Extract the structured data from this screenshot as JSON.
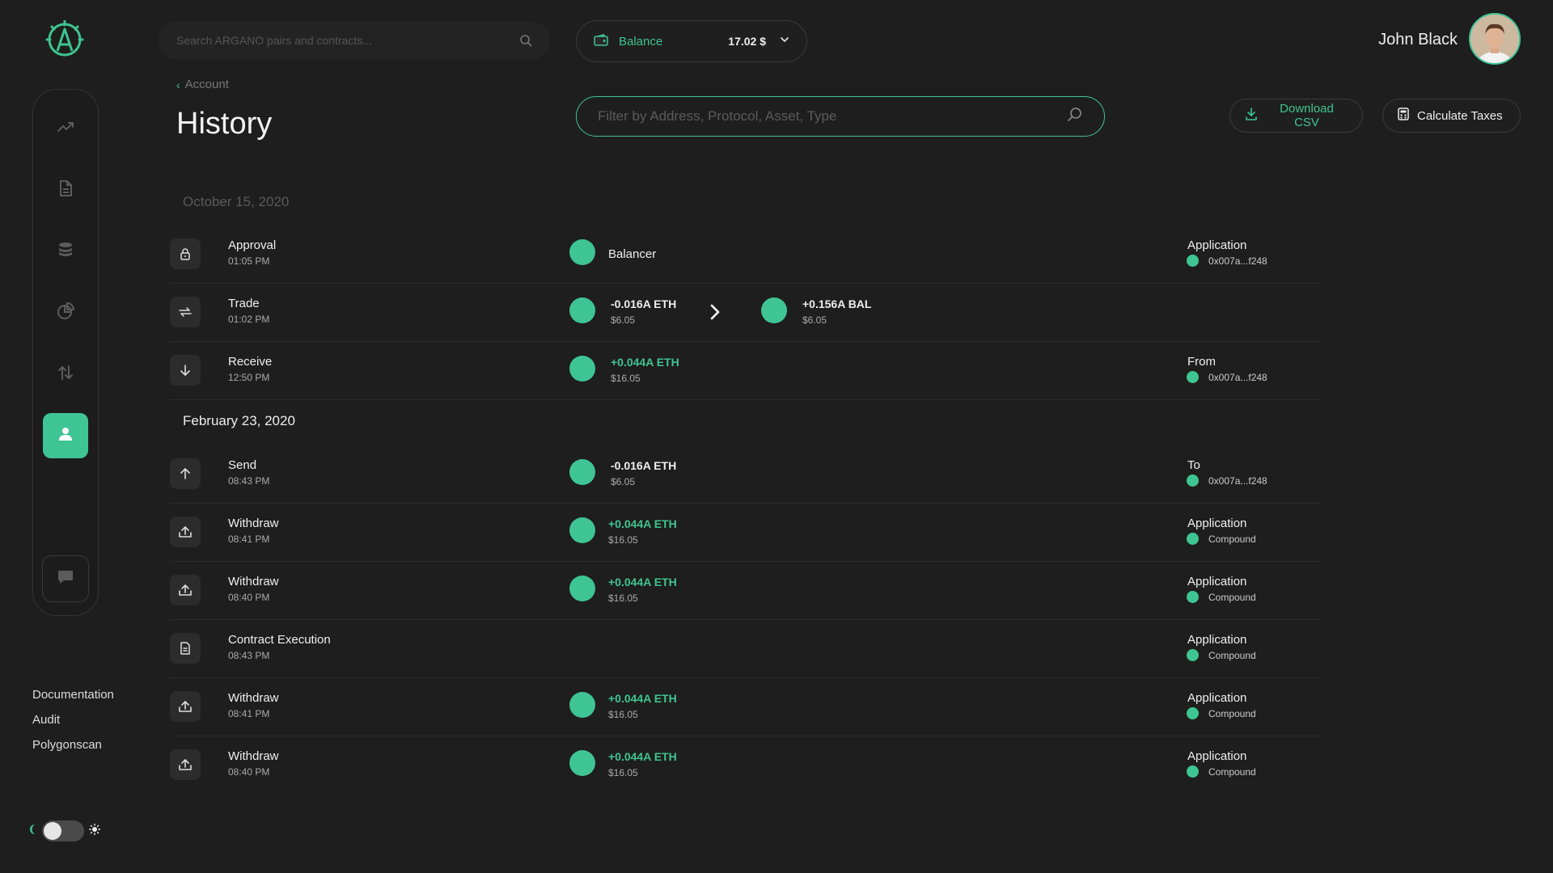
{
  "top_search": {
    "placeholder": "Search ARGANO pairs and contracts..."
  },
  "balance": {
    "label": "Balance",
    "value": "17.02 $"
  },
  "user": {
    "name": "John Black"
  },
  "breadcrumb": {
    "label": "Account"
  },
  "page": {
    "title": "History"
  },
  "filter": {
    "placeholder": "Filter by Address, Protocol, Asset, Type"
  },
  "actions": {
    "download_csv": "Download CSV",
    "calculate_taxes": "Calculate Taxes"
  },
  "side_links": [
    "Documentation",
    "Audit",
    "Polygonscan"
  ],
  "colors": {
    "accent": "#3fc495",
    "background": "#1e1e1e"
  },
  "groups": [
    {
      "date": "October 15, 2020",
      "rows": [
        {
          "type": "Approval",
          "time": "01:05 PM",
          "icon": "lock-icon",
          "protocol": "Balancer",
          "right_label": "Application",
          "right_value": "0x007a...f248"
        },
        {
          "type": "Trade",
          "time": "01:02 PM",
          "icon": "swap-icon",
          "from_amount": "-0.016A ETH",
          "from_usd": "$6.05",
          "to_amount": "+0.156A BAL",
          "to_usd": "$6.05"
        },
        {
          "type": "Receive",
          "time": "12:50 PM",
          "icon": "arrow-down-icon",
          "amount": "+0.044A ETH",
          "usd": "$16.05",
          "right_label": "From",
          "right_value": "0x007a...f248"
        }
      ]
    },
    {
      "date": "February 23, 2020",
      "rows": [
        {
          "type": "Send",
          "time": "08:43 PM",
          "icon": "arrow-up-icon",
          "amount": "-0.016A ETH",
          "usd": "$6.05",
          "right_label": "To",
          "right_value": "0x007a...f248"
        },
        {
          "type": "Withdraw",
          "time": "08:41 PM",
          "icon": "upload-icon",
          "amount": "+0.044A ETH",
          "usd": "$16.05",
          "right_label": "Application",
          "right_value": "Compound"
        },
        {
          "type": "Withdraw",
          "time": "08:40 PM",
          "icon": "upload-icon",
          "amount": "+0.044A ETH",
          "usd": "$16.05",
          "right_label": "Application",
          "right_value": "Compound"
        },
        {
          "type": "Contract Execution",
          "time": "08:43 PM",
          "icon": "document-icon",
          "right_label": "Application",
          "right_value": "Compound"
        },
        {
          "type": "Withdraw",
          "time": "08:41 PM",
          "icon": "upload-icon",
          "amount": "+0.044A ETH",
          "usd": "$16.05",
          "right_label": "Application",
          "right_value": "Compound"
        },
        {
          "type": "Withdraw",
          "time": "08:40 PM",
          "icon": "upload-icon",
          "amount": "+0.044A ETH",
          "usd": "$16.05",
          "right_label": "Application",
          "right_value": "Compound"
        }
      ]
    }
  ]
}
